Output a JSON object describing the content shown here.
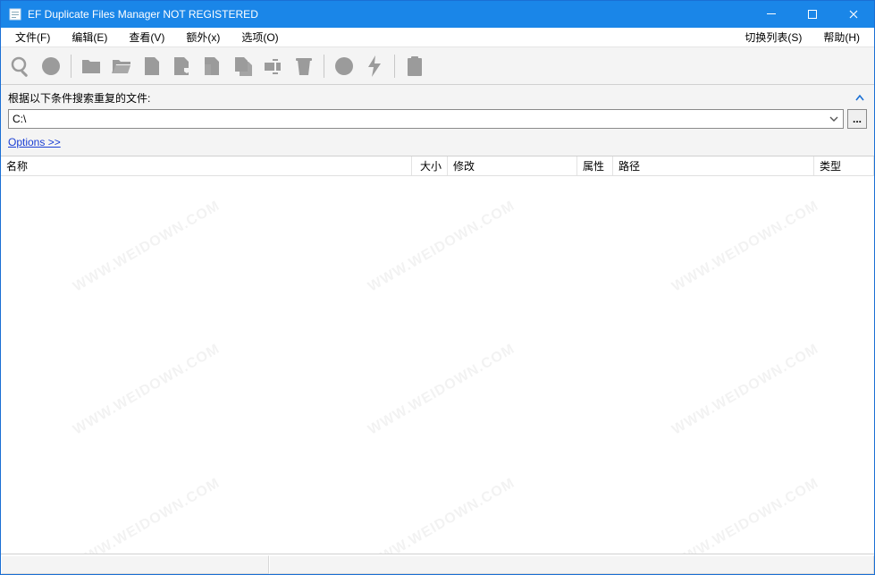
{
  "window": {
    "title": "EF Duplicate Files Manager NOT REGISTERED"
  },
  "menu": {
    "file": "文件(F)",
    "edit": "编辑(E)",
    "view": "查看(V)",
    "extra": "额外(x)",
    "options": "选项(O)",
    "switch_list": "切换列表(S)",
    "help": "帮助(H)"
  },
  "search": {
    "label": "根据以下条件搜索重复的文件:",
    "path_value": "C:\\",
    "browse_label": "...",
    "options_link": "Options  >>"
  },
  "columns": {
    "name": "名称",
    "size": "大小",
    "modified": "修改",
    "attrs": "属性",
    "path": "路径",
    "type": "类型"
  },
  "column_widths": {
    "name": 460,
    "size": 40,
    "modified": 145,
    "attrs": 40,
    "path": 225,
    "type": 65
  },
  "watermark": "WWW.WEIDOWN.COM"
}
